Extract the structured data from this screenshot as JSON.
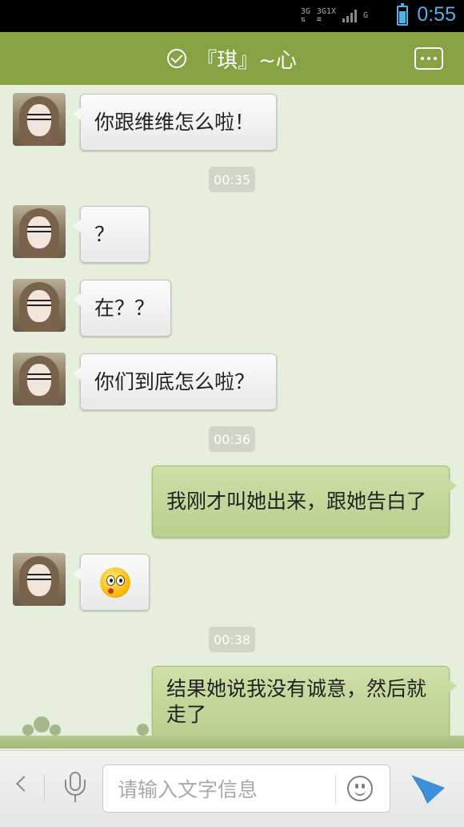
{
  "status_bar": {
    "network_labels": [
      "3G",
      "3G",
      "1X",
      "G"
    ],
    "battery_fraction": 0.8,
    "time": "0:55"
  },
  "header": {
    "title": "『琪』~心"
  },
  "messages": [
    {
      "side": "left",
      "text": "你跟维维怎么啦！"
    },
    {
      "time": "00:35"
    },
    {
      "side": "left",
      "text": "？"
    },
    {
      "side": "left",
      "text": "在？？"
    },
    {
      "side": "left",
      "text": "你们到底怎么啦？"
    },
    {
      "time": "00:36"
    },
    {
      "side": "right",
      "text": "我刚才叫她出来，跟她告白了"
    },
    {
      "side": "left",
      "emoji": "surprised-face"
    },
    {
      "time": "00:38"
    },
    {
      "side": "right",
      "text": "结果她说我没有诚意，然后就走了"
    }
  ],
  "input_bar": {
    "placeholder": "请输入文字信息"
  },
  "colors": {
    "header": "#86a243",
    "status_time": "#4fb3e8",
    "chat_background": "#e6efdc",
    "send_icon": "#3d8fd8"
  }
}
